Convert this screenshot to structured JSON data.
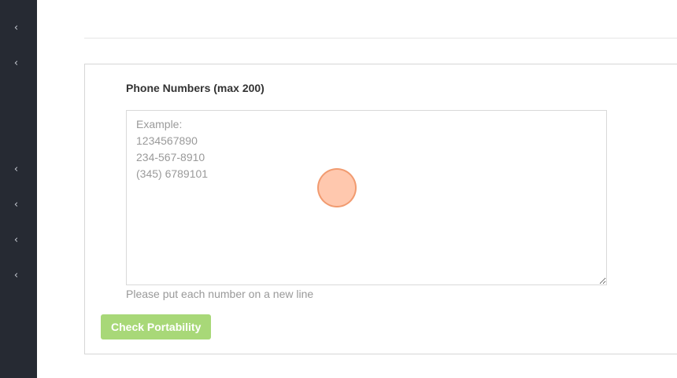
{
  "sidebar": {
    "items": [
      {
        "icon": "chevron-left-icon",
        "glyph": "‹"
      },
      {
        "icon": "chevron-left-icon",
        "glyph": "‹"
      },
      {
        "icon": "chevron-left-icon",
        "glyph": "‹"
      },
      {
        "icon": "chevron-left-icon",
        "glyph": "‹"
      },
      {
        "icon": "chevron-left-icon",
        "glyph": "‹"
      },
      {
        "icon": "chevron-left-icon",
        "glyph": "‹"
      }
    ],
    "background_color": "#262a33"
  },
  "form": {
    "label": "Phone Numbers (max 200)",
    "textarea_placeholder": "Example:\n1234567890\n234-567-8910\n(345) 6789101",
    "textarea_value": "",
    "help_text": "Please put each number on a new line",
    "submit_label": "Check Portability",
    "submit_color": "#a8d878"
  },
  "cursor_marker": {
    "color": "#ffaa82"
  }
}
